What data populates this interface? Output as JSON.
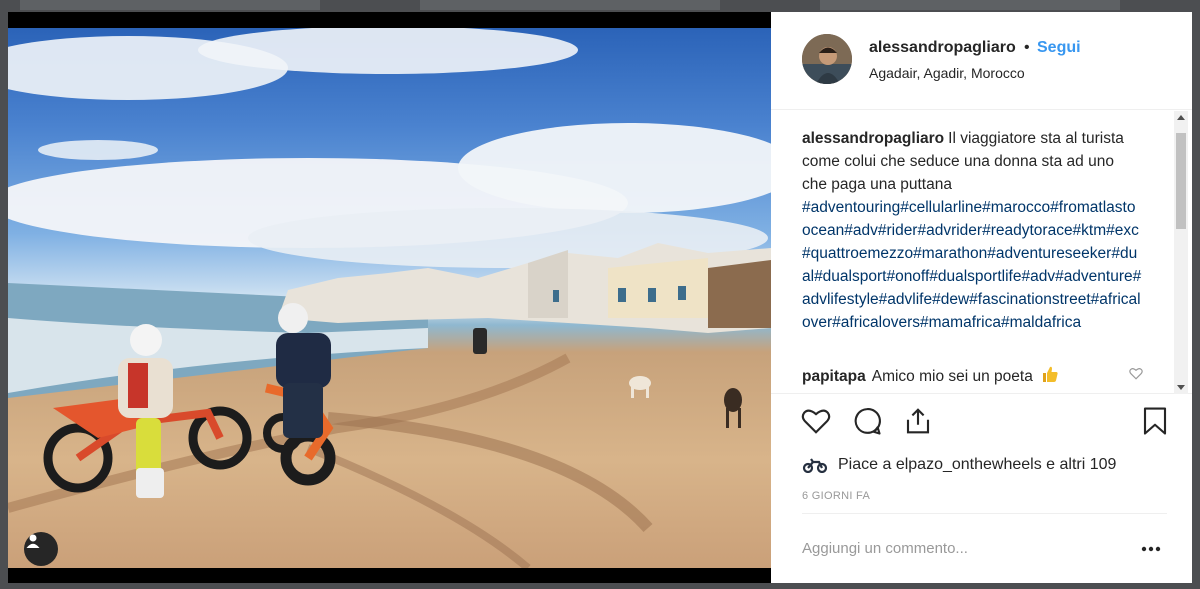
{
  "post": {
    "username": "alessandropagliaro",
    "follow_label": "Segui",
    "separator": "•",
    "location": "Agadair, Agadir, Morocco",
    "caption_text": "Il viaggiatore sta al turista come colui che seduce una donna sta ad uno che paga una puttana",
    "caption_tags": "#adventouring#cellularline#marocco#fromatlastoocean#adv#rider#advrider#readytorace#ktm#exc#quattroemezzo#marathon#adventureseeker#dual#dualsport#onoff#dualsportlife#adv#adventure#advlifestyle#advlife#dew#fascinationstreet#africalover#africalovers#mamafrica#maldafrica",
    "likes_text": "Piace a elpazo_onthewheels e altri 109",
    "date": "6 GIORNI FA",
    "comment_placeholder": "Aggiungi un commento..."
  },
  "comments": [
    {
      "username": "papitapa",
      "text": "Amico mio sei un poeta",
      "emoji_icon": "thumbs-up-icon"
    }
  ],
  "icons": {
    "like": "heart-icon",
    "comment": "speech-bubble-icon",
    "share": "share-icon",
    "save": "bookmark-icon",
    "options": "ellipsis-icon",
    "tag": "user-tag-icon"
  },
  "colors": {
    "link_blue": "#3897f0",
    "hashtag_blue": "#003569",
    "text": "#262626",
    "muted": "#999999"
  }
}
